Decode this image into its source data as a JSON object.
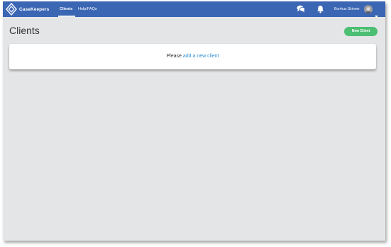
{
  "navbar": {
    "brand": "CaseKeepers",
    "links": [
      {
        "label": "Clients",
        "active": true
      },
      {
        "label": "Help/FAQs",
        "active": false
      }
    ],
    "icons": [
      "chat-icon",
      "bell-icon"
    ],
    "user_name": "Burrhus Skinner"
  },
  "main": {
    "title": "Clients",
    "new_client_label": "New Client",
    "empty_prefix": "Please ",
    "empty_link": "add a new client"
  },
  "colors": {
    "navbar": "#3a66b4",
    "background": "#e4e5e7",
    "accent_green": "#4cbf73",
    "link_blue": "#2d8fd1"
  }
}
